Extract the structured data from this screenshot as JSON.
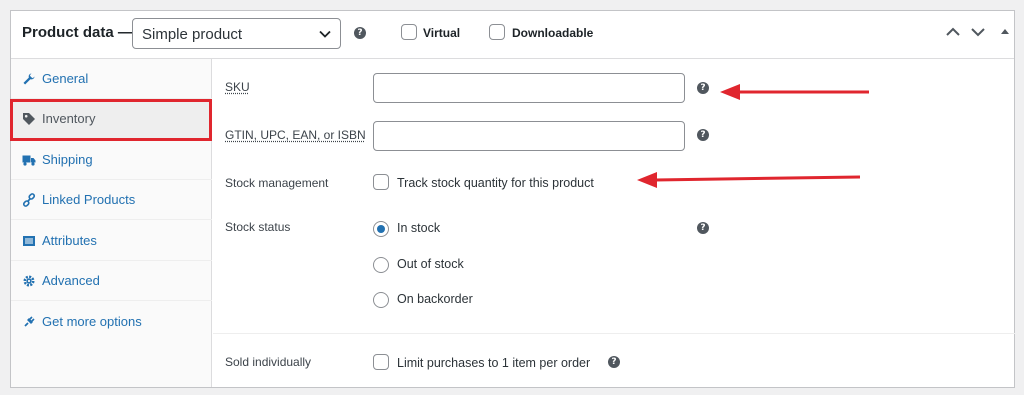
{
  "header": {
    "title": "Product data —",
    "product_type": "Simple product",
    "help": "?",
    "virtual_label": "Virtual",
    "downloadable_label": "Downloadable"
  },
  "sidebar": {
    "items": [
      {
        "label": "General",
        "icon": "wrench-icon"
      },
      {
        "label": "Inventory",
        "icon": "tag-icon"
      },
      {
        "label": "Shipping",
        "icon": "truck-icon"
      },
      {
        "label": "Linked Products",
        "icon": "link-icon"
      },
      {
        "label": "Attributes",
        "icon": "list-icon"
      },
      {
        "label": "Advanced",
        "icon": "gear-icon"
      },
      {
        "label": "Get more options",
        "icon": "plugin-icon"
      }
    ],
    "active": "Inventory"
  },
  "inventory": {
    "sku_label": "SKU",
    "sku_value": "",
    "gtin_label": "GTIN, UPC, EAN, or ISBN",
    "gtin_value": "",
    "stock_management_label": "Stock management",
    "track_stock_label": "Track stock quantity for this product",
    "stock_status_label": "Stock status",
    "stock_options": [
      "In stock",
      "Out of stock",
      "On backorder"
    ],
    "stock_selected": "In stock",
    "sold_individually_label": "Sold individually",
    "limit_label": "Limit purchases to 1 item per order"
  },
  "colors": {
    "annotation_red": "#e0262e",
    "link_blue": "#2271b1"
  }
}
